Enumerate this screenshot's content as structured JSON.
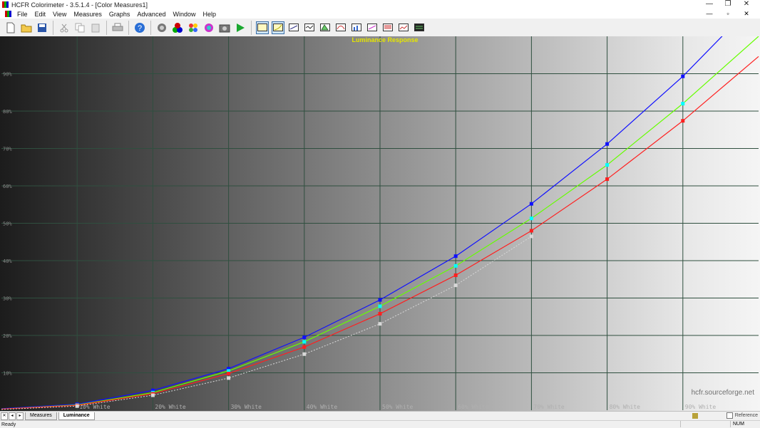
{
  "window": {
    "title": "HCFR Colorimeter - 3.5.1.4 - [Color Measures1]",
    "controls": [
      "—",
      "❐",
      "✕"
    ]
  },
  "menu": {
    "items": [
      "File",
      "Edit",
      "View",
      "Measures",
      "Graphs",
      "Advanced",
      "Window",
      "Help"
    ],
    "mdi_controls": [
      "—",
      "▫",
      "✕"
    ]
  },
  "toolbar": {
    "groups": [
      [
        "new-icon",
        "open-icon",
        "save-icon"
      ],
      [
        "cut-icon",
        "copy-icon",
        "paste-icon"
      ],
      [
        "print-icon"
      ],
      [
        "help-icon"
      ],
      [
        "sensor-icon",
        "generator-icon",
        "color-checker-icon",
        "saturation-icon",
        "camera-icon",
        "play-icon"
      ],
      [
        "view-main-icon",
        "view-luminance-icon",
        "view-gamma-icon",
        "view-rgb-icon",
        "view-cie-icon",
        "view-colortemp-icon",
        "view-deltae-icon",
        "view-saturation-icon",
        "view-near-black-icon",
        "view-near-white-icon",
        "view-measures-icon"
      ]
    ],
    "selected": [
      "view-main-icon",
      "view-luminance-icon"
    ]
  },
  "chart_data": {
    "type": "line",
    "title": "Luminance Response",
    "watermark": "hcfr.sourceforge.net",
    "x": [
      0,
      10,
      20,
      30,
      40,
      50,
      60,
      70,
      80,
      90,
      100
    ],
    "x_tick_labels": [
      "",
      "10% White",
      "20% White",
      "30% White",
      "40% White",
      "50% White",
      "60% White",
      "70% White",
      "80% White",
      "90% White",
      ""
    ],
    "ylim": [
      0,
      100
    ],
    "y_ticks": [
      10,
      20,
      30,
      40,
      50,
      60,
      70,
      80,
      90
    ],
    "y_tick_labels": [
      "10%",
      "20%",
      "30%",
      "40%",
      "50%",
      "60%",
      "70%",
      "80%",
      "90%"
    ],
    "grid": true,
    "series": [
      {
        "color": "#1010ff",
        "values": [
          0.4,
          1.6,
          5.3,
          11.1,
          19.5,
          29.5,
          41.2,
          55.2,
          71.2,
          89.3,
          110
        ]
      },
      {
        "color": "#66ff00",
        "values": [
          0.3,
          1.4,
          4.7,
          10.5,
          18.3,
          27.8,
          38.6,
          51.3,
          65.6,
          82.0,
          100
        ]
      },
      {
        "color": "#ff2020",
        "values": [
          0.3,
          1.3,
          4.4,
          9.8,
          16.9,
          25.8,
          36.1,
          48.0,
          61.8,
          77.4,
          94.6
        ]
      },
      {
        "color": "#d8d8d8",
        "dashed": true,
        "values": [
          0.2,
          1.1,
          4.0,
          8.6,
          15.0,
          23.1,
          33.4,
          46.5,
          null,
          null,
          null
        ]
      }
    ],
    "marker_colors": [
      "#1010ff",
      "#00ffff",
      "#ff2020",
      "#d8d8d8"
    ]
  },
  "tabs": {
    "nav": [
      "✕",
      "◂",
      "▸"
    ],
    "items": [
      "Measures",
      "Luminance"
    ],
    "active": "Luminance",
    "reference_label": "Reference"
  },
  "status": {
    "text": "Ready",
    "num": "NUM"
  }
}
